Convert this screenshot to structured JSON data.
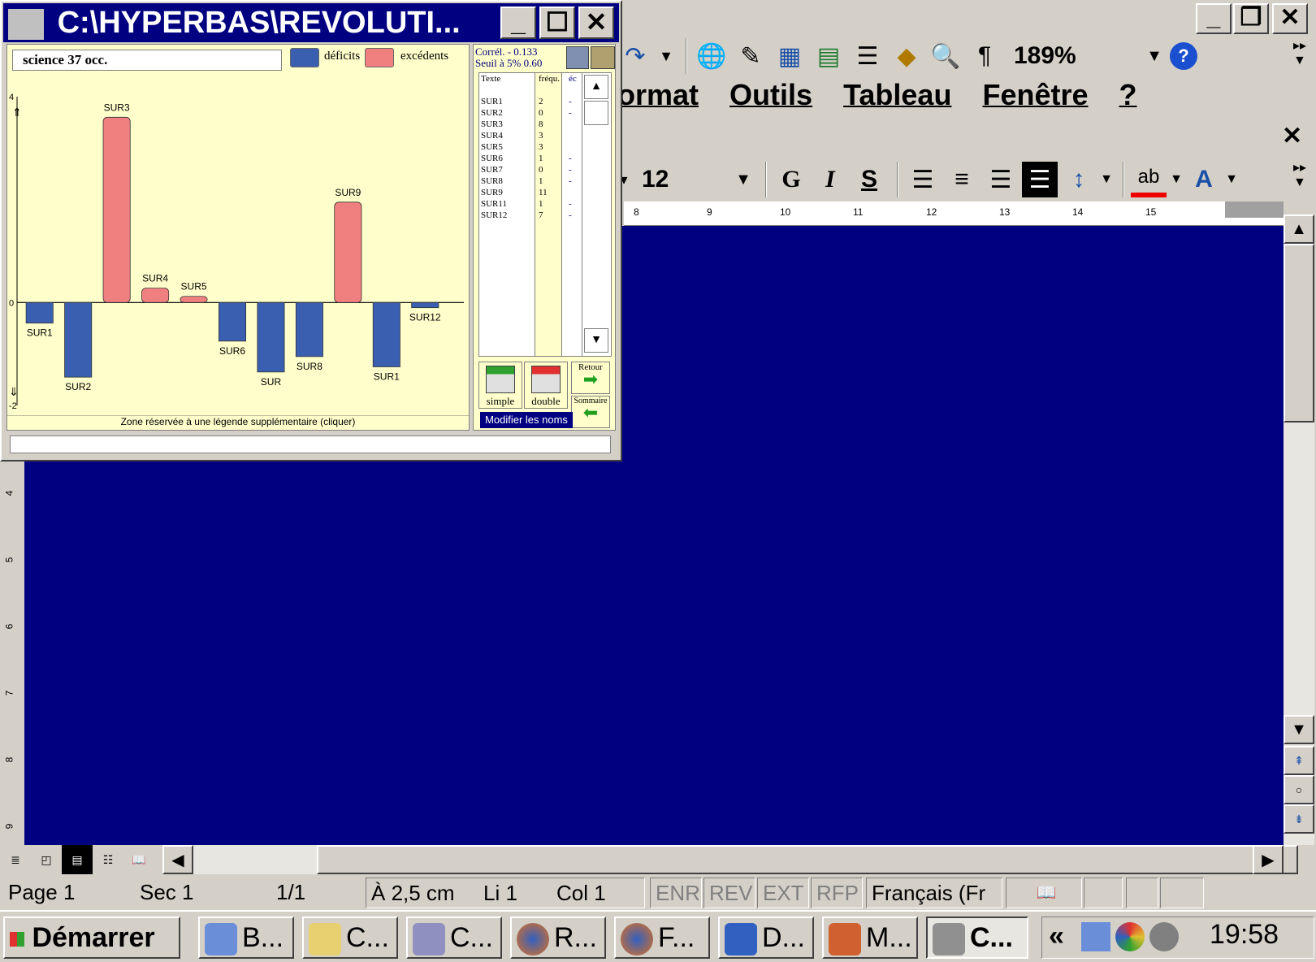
{
  "word": {
    "zoom": "189%",
    "menu": [
      "ormat",
      "Outils",
      "Tableau",
      "Fenêtre",
      "?"
    ],
    "font_size": "12",
    "format_buttons": {
      "bold": "G",
      "italic": "I",
      "strike": "S"
    },
    "ruler_ticks": [
      "8",
      "9",
      "10",
      "11",
      "12",
      "13",
      "14",
      "15"
    ],
    "vruler_ticks": [
      "4",
      "5",
      "6",
      "7",
      "8",
      "9"
    ],
    "status": {
      "page": "Page 1",
      "sec": "Sec 1",
      "pages": "1/1",
      "pos": "À 2,5 cm",
      "line": "Li 1",
      "col": "Col 1",
      "enr": "ENR",
      "rev": "REV",
      "ext": "EXT",
      "rfp": "RFP",
      "lang": "Français (Fr"
    },
    "accent_doc": "#000080"
  },
  "taskbar": {
    "start": "Démarrer",
    "buttons": [
      "B...",
      "C...",
      "C...",
      "R...",
      "F...",
      "D...",
      "M...",
      "C..."
    ],
    "clock": "19:58",
    "chevron": "«"
  },
  "hyperbase": {
    "title": "C:\\HYPERBAS\\REVOLUTI...",
    "header": "science  37 occ.",
    "legend_deficit": "déficits",
    "legend_excess": "excédents",
    "color_deficit": "#3a5fb0",
    "color_excess": "#f08080",
    "corr_line1": "Corrél. - 0.133",
    "corr_line2": "Seuil à 5%   0.60",
    "list_headers": [
      "Texte",
      "fréqu.",
      "éc"
    ],
    "list_rows": [
      {
        "t": "SUR1",
        "f": "2",
        "e": "-"
      },
      {
        "t": "SUR2",
        "f": "0",
        "e": "-"
      },
      {
        "t": "SUR3",
        "f": "8",
        "e": ""
      },
      {
        "t": "SUR4",
        "f": "3",
        "e": ""
      },
      {
        "t": "SUR5",
        "f": "3",
        "e": ""
      },
      {
        "t": "SUR6",
        "f": "1",
        "e": "-"
      },
      {
        "t": "SUR7",
        "f": "0",
        "e": "-"
      },
      {
        "t": "SUR8",
        "f": "1",
        "e": "-"
      },
      {
        "t": "SUR9",
        "f": "11",
        "e": ""
      },
      {
        "t": "SUR11",
        "f": "1",
        "e": "-"
      },
      {
        "t": "SUR12",
        "f": "7",
        "e": "-"
      }
    ],
    "btn_simple": "simple",
    "btn_double": "double",
    "btn_retour": "Retour",
    "btn_sommaire": "Sommaire",
    "btn_modifier": "Modifier les noms",
    "legend_zone": "Zone réservée à une légende supplémentaire (cliquer)"
  },
  "chart_data": {
    "type": "bar",
    "categories": [
      "SUR1",
      "SUR2",
      "SUR3",
      "SUR4",
      "SUR5",
      "SUR6",
      "SUR",
      "SUR8",
      "SUR9",
      "SUR1",
      "SUR12"
    ],
    "values": [
      -0.4,
      -1.45,
      3.6,
      0.28,
      0.12,
      -0.75,
      -1.35,
      -1.05,
      1.95,
      -1.25,
      -0.1
    ],
    "ylim": [
      -2,
      4
    ],
    "yticks": [
      "4",
      "0",
      "-2"
    ],
    "xlabel": "",
    "ylabel": ""
  }
}
